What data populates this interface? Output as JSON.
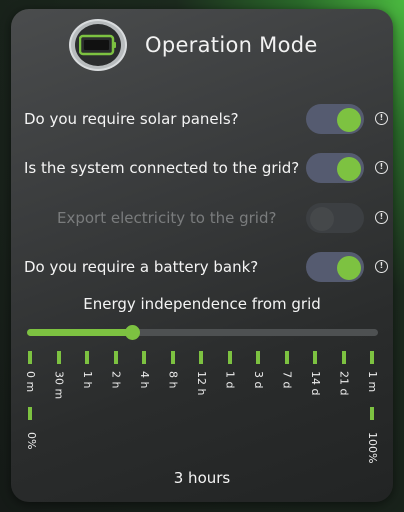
{
  "header": {
    "title": "Operation Mode",
    "logo_icon": "battery-icon"
  },
  "questions": [
    {
      "label": "Do you require solar panels?",
      "state": "on",
      "enabled": true
    },
    {
      "label": "Is the system connected to the grid?",
      "state": "on",
      "enabled": true
    },
    {
      "label": "Export electricity to the grid?",
      "state": "off",
      "enabled": false
    },
    {
      "label": "Do you require a battery bank?",
      "state": "on",
      "enabled": true
    }
  ],
  "info_glyph": "!",
  "slider": {
    "title": "Energy independence from grid",
    "ticks": [
      "0 m",
      "30 m",
      "1 h",
      "2 h",
      "4 h",
      "8 h",
      "12 h",
      "1 d",
      "3 d",
      "7 d",
      "14 d",
      "21 d",
      "1 m"
    ],
    "min_label": "0%",
    "max_label": "100%",
    "value_fraction": 0.3,
    "value_label": "3 hours"
  },
  "colors": {
    "accent": "#7dc241",
    "toggle_track": "#555b70",
    "panel": "#3a3c3d"
  }
}
